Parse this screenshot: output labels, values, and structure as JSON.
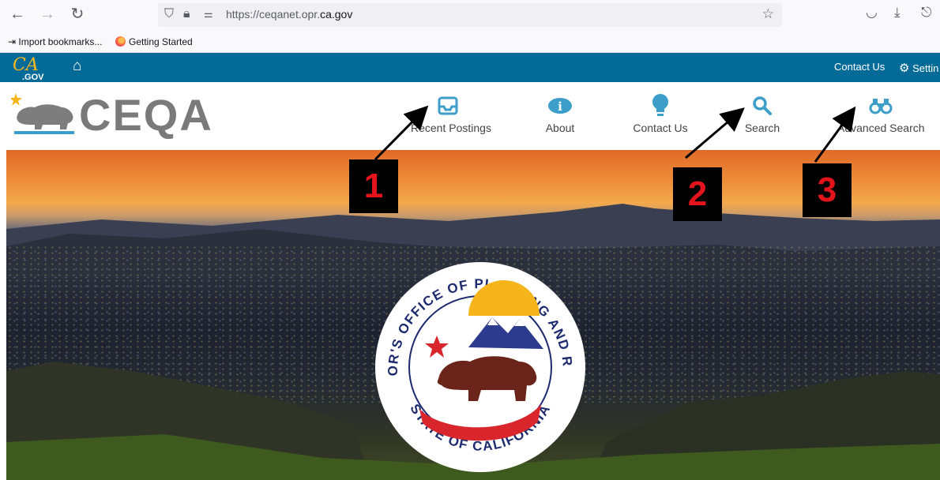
{
  "browser": {
    "back_icon": "arrow-left-icon",
    "forward_icon": "arrow-right-icon",
    "reload_icon": "reload-icon",
    "url_prefix": "https://ceqanet.opr.",
    "url_domain": "ca.gov",
    "bookmarks": [
      {
        "label": "Import bookmarks...",
        "icon": "import-icon"
      },
      {
        "label": "Getting Started",
        "icon": "firefox-icon"
      }
    ]
  },
  "ca_bar": {
    "logo_text": "CA",
    "logo_sub": ".GOV",
    "contact_label": "Contact Us",
    "settings_label": "Settin",
    "bar_color": "#046b99"
  },
  "header": {
    "site_title": "CEQA",
    "nav": [
      {
        "label": "Recent Postings",
        "icon": "inbox-tray-icon"
      },
      {
        "label": "About",
        "icon": "info-icon"
      },
      {
        "label": "Contact Us",
        "icon": "lightbulb-icon"
      },
      {
        "label": "Search",
        "icon": "search-icon"
      },
      {
        "label": "Advanced Search",
        "icon": "binoculars-icon"
      }
    ],
    "accent_color": "#3d9ec9"
  },
  "seal": {
    "top_text": "GOVERNOR'S OFFICE OF PLANNING AND RESEARCH",
    "bottom_text": "STATE OF CALIFORNIA"
  },
  "annotations": {
    "callouts": [
      "1",
      "2",
      "3"
    ],
    "color": "#e3141b"
  }
}
